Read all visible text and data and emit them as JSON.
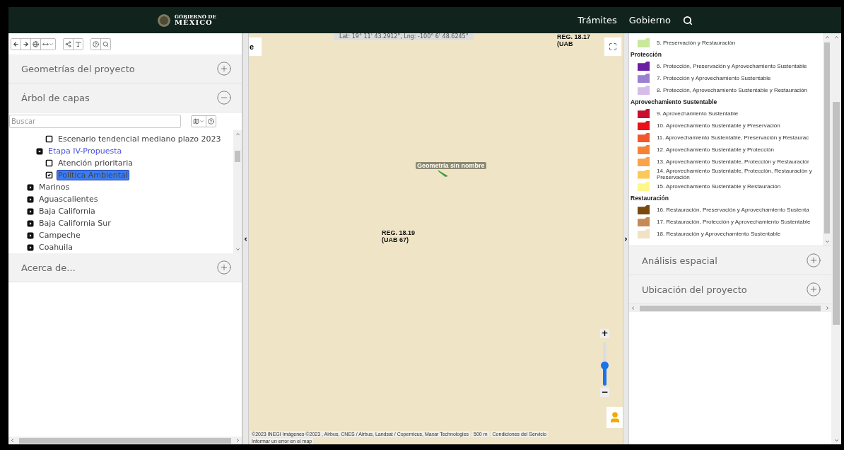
{
  "header": {
    "logo_top": "GOBIERNO DE",
    "logo_bottom": "MÉXICO",
    "nav": [
      "Trámites",
      "Gobierno"
    ]
  },
  "left_panel": {
    "sections_top": [
      {
        "title": "Geometrías del proyecto",
        "expanded": false
      },
      {
        "title": "Árbol de capas",
        "expanded": true
      }
    ],
    "search": {
      "placeholder": "Buscar"
    },
    "tree": [
      {
        "kind": "folder",
        "expanded": true,
        "children": [
          {
            "kind": "folder",
            "expanded": true,
            "children": [
              {
                "kind": "layer",
                "label": "Escenario tendencial mediano plazo 2023",
                "checked": false,
                "selected": false
              }
            ]
          },
          {
            "kind": "folder",
            "label": "Etapa IV-Propuesta",
            "expanded": true,
            "active": true,
            "children": [
              {
                "kind": "layer",
                "label": "Atención prioritaria",
                "checked": false,
                "selected": false
              },
              {
                "kind": "layer",
                "label": "Política Ambiental",
                "checked": true,
                "selected": true
              }
            ]
          }
        ]
      },
      {
        "kind": "folder",
        "label": "Marinos",
        "expanded": false,
        "active": false
      },
      {
        "kind": "folder",
        "label": "Aguascalientes",
        "expanded": false,
        "active": false
      },
      {
        "kind": "folder",
        "label": "Baja California",
        "expanded": false,
        "active": false
      },
      {
        "kind": "folder",
        "label": "Baja California Sur",
        "expanded": false,
        "active": false
      },
      {
        "kind": "folder",
        "label": "Campeche",
        "expanded": false,
        "active": false
      },
      {
        "kind": "folder",
        "label": "Coahuila",
        "expanded": false,
        "active": false
      }
    ],
    "sections_bottom": [
      {
        "title": "Acerca de...",
        "expanded": false
      }
    ]
  },
  "map": {
    "coordinates": "Lat: 19° 11' 43.2912\", Lng: -100° 6' 48.6245\"",
    "partial_control": "e",
    "labels": [
      {
        "lines": [
          "REG. 18.19",
          "(UAB 67)"
        ],
        "kind": "center"
      },
      {
        "lines": [
          "REG. 18.17",
          "(UAB"
        ],
        "kind": "corner"
      }
    ],
    "geometry_label": "Geometría sin nombre",
    "zoom": {
      "plus": "+",
      "minus": "−",
      "level": 0.45
    },
    "footer": [
      "©2023 INEGI Imágenes ©2023 , Airbus, CNES / Airbus, Landsat / Copernicus, Maxar Technologies",
      "500 m",
      "Condiciones del Servicio",
      "Informar un error en el map"
    ]
  },
  "legend": [
    {
      "kind": "entry",
      "label": "5. Preservación y Restauración",
      "color": "#c8e89a"
    },
    {
      "kind": "heading",
      "label": "Protección"
    },
    {
      "kind": "entry",
      "label": "6. Protección, Preservación y Aprovechamiento Sustentable",
      "color": "#6b1fa3"
    },
    {
      "kind": "entry",
      "label": "7. Protección y Aprovechamiento Sustentable",
      "color": "#9a7fd2"
    },
    {
      "kind": "entry",
      "label": "8. Protección, Aprovechamiento Sustentable y Restauración",
      "color": "#d6bde8"
    },
    {
      "kind": "heading",
      "label": "Aprovechamiento Sustentable"
    },
    {
      "kind": "entry",
      "label": "9.  Aprovechamiento Sustentable",
      "color": "#c8102e"
    },
    {
      "kind": "entry",
      "label": "10. Aprovechamiento Sustentable y Preservación",
      "color": "#ea1119"
    },
    {
      "kind": "entry",
      "label": "11. Aprovechamiento Sustentable, Preservación y Restaurac",
      "color": "#f2582c"
    },
    {
      "kind": "entry",
      "label": "12. Aprovechamiento Sustentable y Protección",
      "color": "#f88234"
    },
    {
      "kind": "entry",
      "label": "13. Aprovechamiento Sustentable, Protección y Restauraciór",
      "color": "#f9a34b"
    },
    {
      "kind": "entry",
      "label": "14. Aprovechamiento Sustentable, Protección, Restauración y Preservación",
      "color": "#fcc857"
    },
    {
      "kind": "entry",
      "label": "15. Aprovechamiento Sustentable y Restauración",
      "color": "#fff68c"
    },
    {
      "kind": "heading",
      "label": "Restauración"
    },
    {
      "kind": "entry",
      "label": "16. Restauración, Preservación y Aprovechamiento Sustenta",
      "color": "#7a4a0c"
    },
    {
      "kind": "entry",
      "label": "17. Restauración, Protección y Aprovechamiento Sustentable",
      "color": "#c68a55"
    },
    {
      "kind": "entry",
      "label": "18. Restauración y Aprovechamiento Sustentable",
      "color": "#f0e2c2"
    }
  ],
  "right_sections": [
    {
      "title": "Análisis espacial",
      "expanded": false
    },
    {
      "title": "Ubicación del proyecto",
      "expanded": false
    }
  ]
}
